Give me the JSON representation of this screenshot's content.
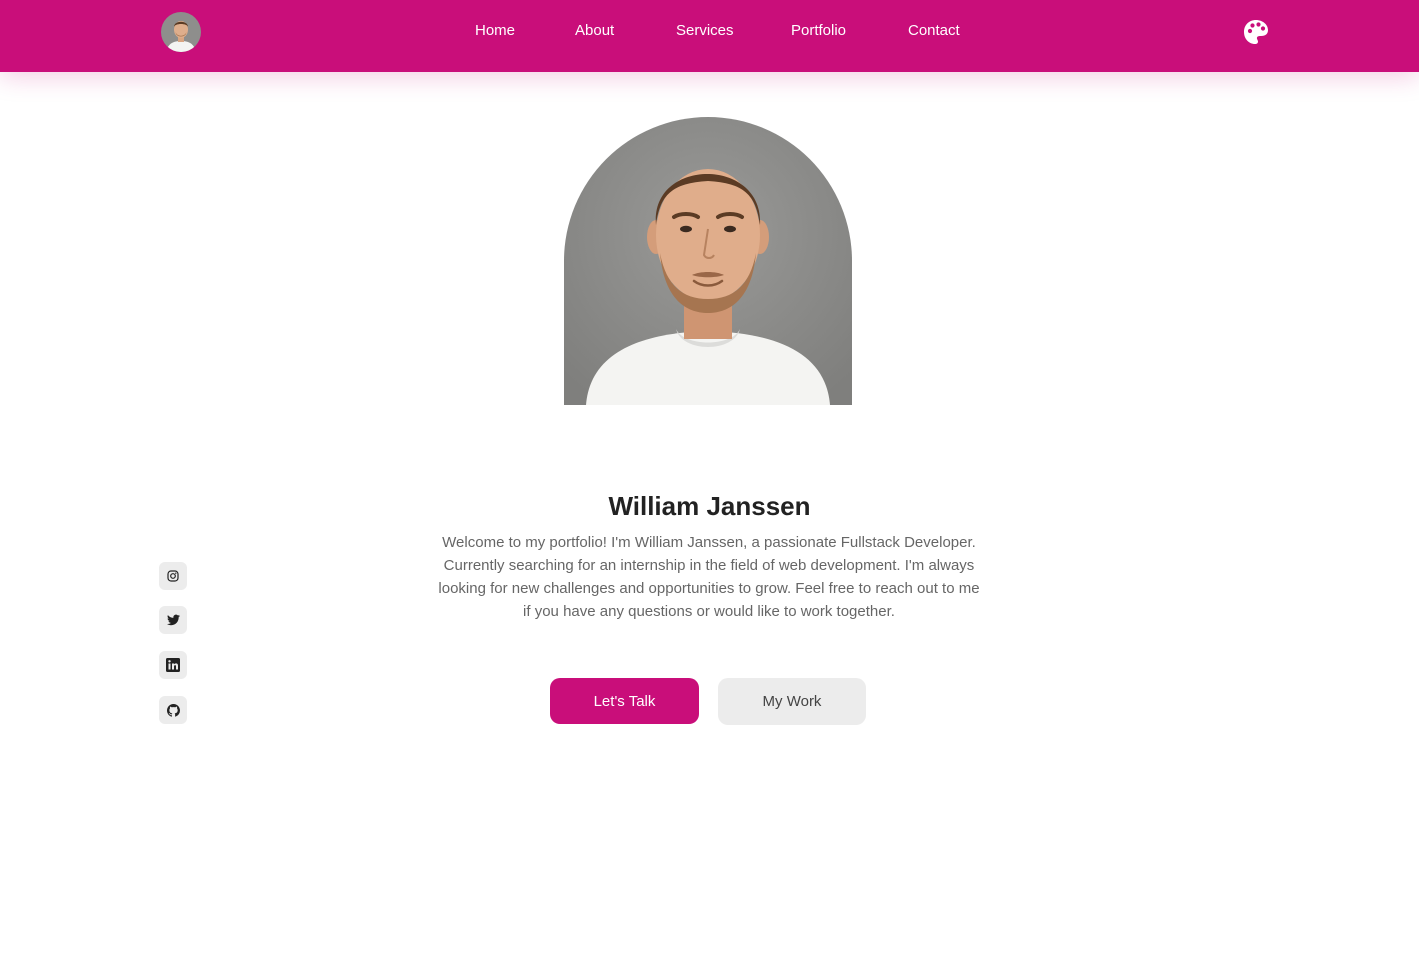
{
  "header": {
    "avatar_icon": "profile-avatar",
    "nav": [
      {
        "label": "Home"
      },
      {
        "label": "About"
      },
      {
        "label": "Services"
      },
      {
        "label": "Portfolio"
      },
      {
        "label": "Contact"
      }
    ],
    "theme_icon": "palette-icon"
  },
  "hero": {
    "photo": "portrait-photo",
    "name": "William Janssen",
    "bio": "Welcome to my portfolio! I'm William Janssen, a passionate Fullstack Developer. Currently searching for an internship in the field of web development. I'm always looking for new challenges and opportunities to grow. Feel free to reach out to me if you have any questions or would like to work together.",
    "primary_button": "Let's Talk",
    "secondary_button": "My Work"
  },
  "social": [
    {
      "icon": "instagram-icon"
    },
    {
      "icon": "twitter-icon"
    },
    {
      "icon": "linkedin-icon"
    },
    {
      "icon": "github-icon"
    }
  ],
  "colors": {
    "accent": "#c90e7a",
    "text_dark": "#222222",
    "text_muted": "#666666",
    "button_light": "#ececec",
    "photo_background": "#8c8c8a"
  }
}
